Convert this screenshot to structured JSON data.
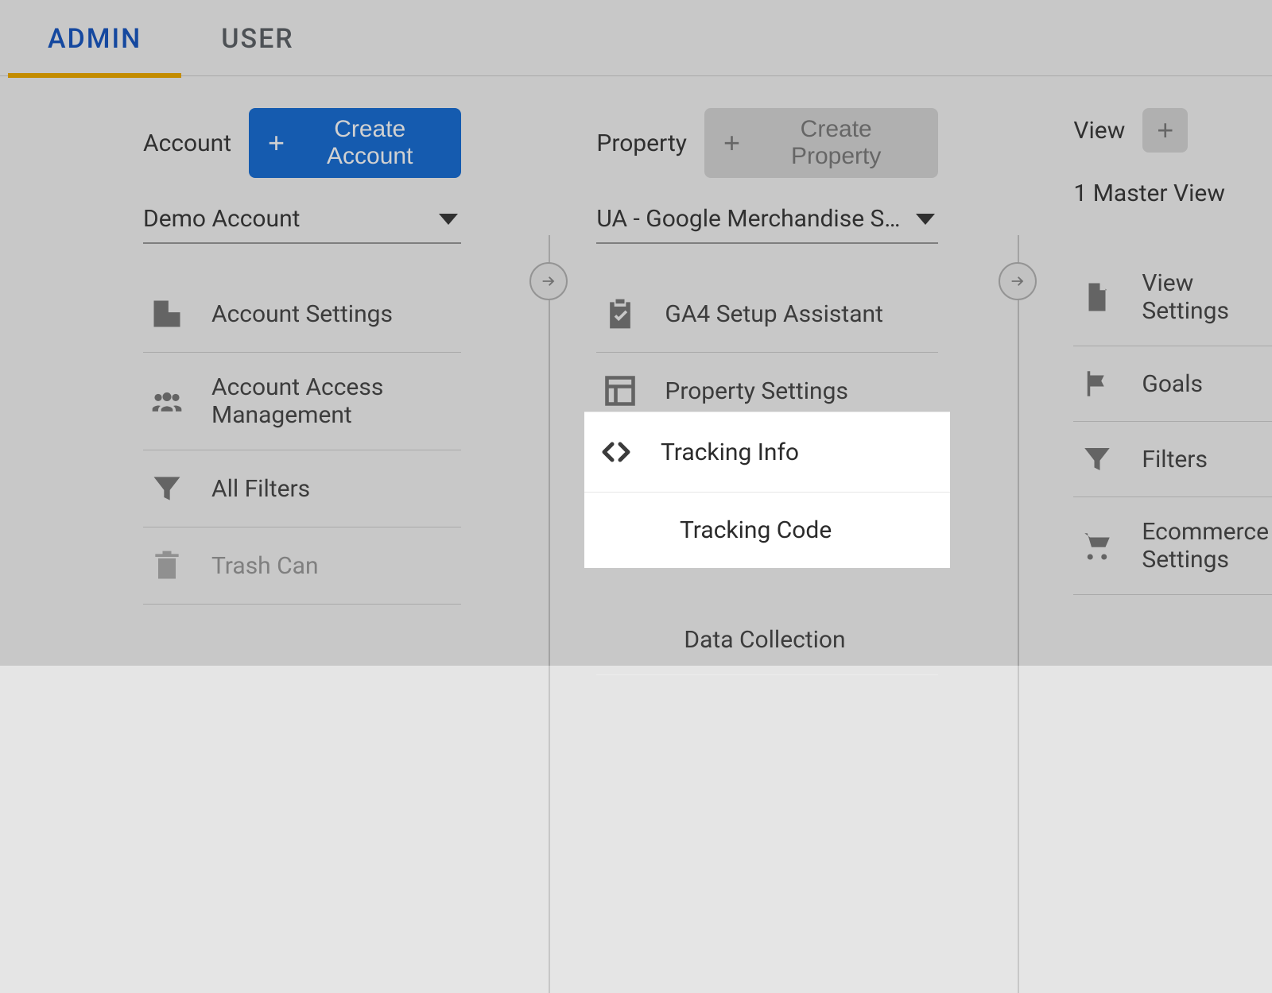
{
  "tabs": {
    "admin": "ADMIN",
    "user": "USER"
  },
  "account": {
    "label": "Account",
    "create": "Create Account",
    "selected": "Demo Account",
    "items": [
      {
        "label": "Account Settings"
      },
      {
        "label": "Account Access Management"
      },
      {
        "label": "All Filters"
      },
      {
        "label": "Trash Can"
      }
    ]
  },
  "property": {
    "label": "Property",
    "create": "Create Property",
    "selected": "UA - Google Merchandise Sto…",
    "items": [
      {
        "label": "GA4 Setup Assistant"
      },
      {
        "label": "Property Settings"
      },
      {
        "label": "Tracking Info"
      },
      {
        "label": "Data Collection"
      }
    ],
    "tracking_sub": [
      {
        "label": "Tracking Code"
      }
    ]
  },
  "view": {
    "label": "View",
    "selected": "1 Master View",
    "items": [
      {
        "label": "View Settings"
      },
      {
        "label": "Goals"
      },
      {
        "label": "Filters"
      },
      {
        "label": "Ecommerce Settings"
      }
    ]
  }
}
